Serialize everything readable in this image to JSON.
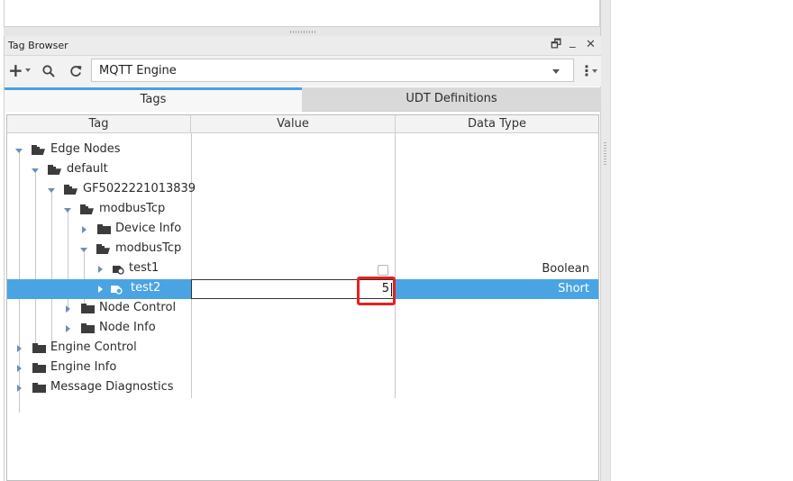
{
  "panel": {
    "title": "Tag Browser",
    "restore_glyph": "🗗",
    "minimize_glyph": "_",
    "close_glyph": "✕"
  },
  "toolbar": {
    "add_glyph": "+",
    "search_icon": "search-icon",
    "refresh_icon": "refresh-icon",
    "provider": "MQTT Engine",
    "menu_glyph": "⋮"
  },
  "tabs": [
    {
      "label": "Tags",
      "active": true
    },
    {
      "label": "UDT Definitions",
      "active": false
    }
  ],
  "columns": {
    "tag": "Tag",
    "value": "Value",
    "data_type": "Data Type"
  },
  "tree": [
    {
      "label": "Edge Nodes"
    },
    {
      "label": "default"
    },
    {
      "label": "GF5022221013839"
    },
    {
      "label": "modbusTcp"
    },
    {
      "label": "Device Info"
    },
    {
      "label": "modbusTcp"
    },
    {
      "label": "test1",
      "value": false,
      "data_type": "Boolean"
    },
    {
      "label": "test2",
      "value": "5",
      "data_type": "Short",
      "selected": true
    },
    {
      "label": "Node Control"
    },
    {
      "label": "Node Info"
    },
    {
      "label": "Engine Control"
    },
    {
      "label": "Engine Info"
    },
    {
      "label": "Message Diagnostics"
    }
  ],
  "colors": {
    "selection": "#4aa4e4",
    "highlight": "#e82020",
    "active_tab_accent": "#4a9fe0"
  }
}
